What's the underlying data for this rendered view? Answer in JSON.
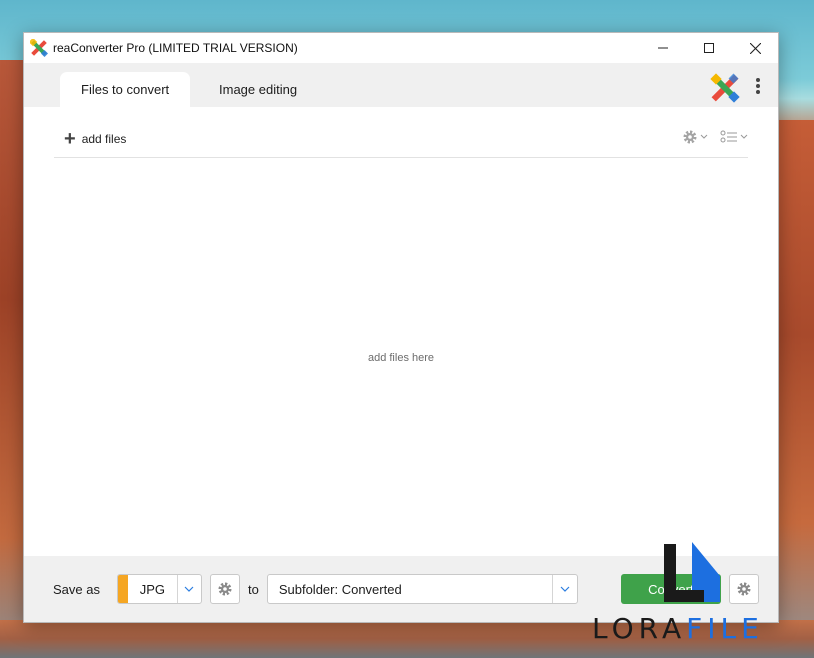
{
  "window": {
    "title": "reaConverter Pro  (LIMITED TRIAL VERSION)"
  },
  "tabs": [
    {
      "label": "Files to convert",
      "active": true
    },
    {
      "label": "Image editing",
      "active": false
    }
  ],
  "toolbar": {
    "add_files_label": "add files"
  },
  "dropzone": {
    "hint": "add files here"
  },
  "bottom": {
    "save_as_label": "Save as",
    "format_value": "JPG",
    "format_color": "#f5a623",
    "to_label": "to",
    "destination_value": "Subfolder: Converted",
    "convert_label": "Convert"
  },
  "watermark": {
    "text_dark": "LORA",
    "text_blue": "FILE"
  },
  "colors": {
    "convert_button": "#3fa24a",
    "tab_bar": "#f0f0f0",
    "watermark_blue": "#1d6fe0"
  }
}
